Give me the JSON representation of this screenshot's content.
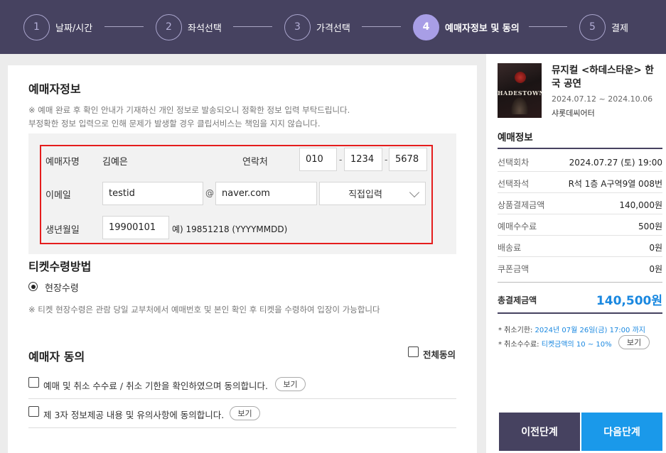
{
  "steps": [
    {
      "num": "1",
      "label": "날짜/시간"
    },
    {
      "num": "2",
      "label": "좌석선택"
    },
    {
      "num": "3",
      "label": "가격선택"
    },
    {
      "num": "4",
      "label": "예매자정보 및 동의"
    },
    {
      "num": "5",
      "label": "결제"
    }
  ],
  "booker": {
    "title": "예매자정보",
    "notice1": "※ 예매 완료 후 확인 안내가 기재하신 개인 정보로 발송되오니 정확한 정보 입력 부탁드립니다.",
    "notice2": "부정확한 정보 입력으로 인해 문제가 발생할 경우 클립서비스는 책임을 지지 않습니다.",
    "name_label": "예매자명",
    "name_value": "김예은",
    "phone_label": "연락처",
    "phone1": "010",
    "phone2": "1234",
    "phone3": "5678",
    "phone_dash": "-",
    "email_label": "이메일",
    "email_id": "testid",
    "email_at": "@",
    "email_domain": "naver.com",
    "email_select": "직접입력",
    "birth_label": "생년월일",
    "birth_value": "19900101",
    "birth_example": "예) 19851218 (YYYYMMDD)"
  },
  "ticket": {
    "title": "티켓수령방법",
    "option": "현장수령",
    "notice": "※ 티켓 현장수령은 관람 당일 교부처에서 예매번호 및 본인 확인 후 티켓을 수령하여 입장이 가능합니다"
  },
  "agree": {
    "title": "예매자 동의",
    "all_label": "전체동의",
    "item1": "예매 및 취소 수수료 / 취소 기한을 확인하였으며 동의합니다.",
    "item2": "제 3자 정보제공 내용 및 유의사항에 동의합니다.",
    "view": "보기"
  },
  "sidebar": {
    "poster_text": "HADESTOWN",
    "perf_title": "뮤지컬 <하데스타운> 한국 공연",
    "period": "2024.07.12 ~ 2024.10.06",
    "venue": "샤롯데씨어터",
    "info_title": "예매정보",
    "rows": [
      {
        "k": "선택회차",
        "v": "2024.07.27 (토) 19:00"
      },
      {
        "k": "선택좌석",
        "v": "R석 1층 A구역9열 008번"
      },
      {
        "k": "상품결제금액",
        "v": "140,000원"
      },
      {
        "k": "예매수수료",
        "v": "500원"
      },
      {
        "k": "배송료",
        "v": "0원"
      },
      {
        "k": "쿠폰금액",
        "v": "0원"
      }
    ],
    "total_label": "총결제금액",
    "total_value": "140,500원",
    "cancel_deadline_label": "* 취소기한:",
    "cancel_deadline_value": "2024년 07월 26일(금) 17:00 까지",
    "cancel_fee_label": "* 취소수수료:",
    "cancel_fee_value": "티켓금액의 10 ~ 10%",
    "view": "보기",
    "prev": "이전단계",
    "next": "다음단계"
  },
  "colors": {
    "nav": "#464260",
    "active": "#a89ee6",
    "accent": "#1a99ea",
    "highlight_border": "#e51d1d"
  }
}
